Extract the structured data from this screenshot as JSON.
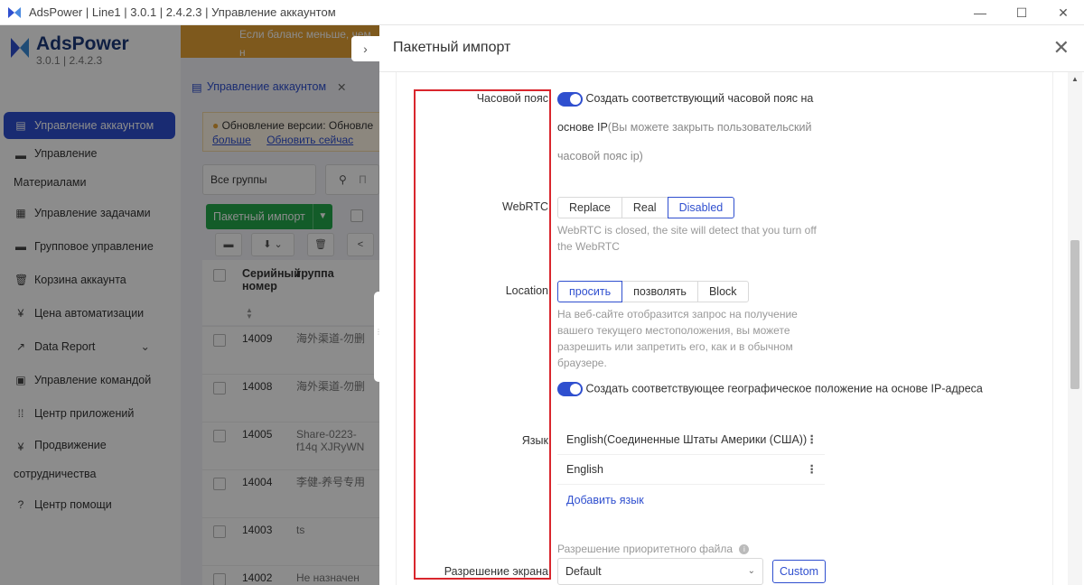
{
  "window": {
    "title": "AdsPower | Line1 | 3.0.1 | 2.4.2.3 | Управление аккаунтом",
    "minimize_glyph": "—",
    "maximize_glyph": "☐",
    "close_glyph": "✕"
  },
  "brand": {
    "name": "AdsPower",
    "version": "3.0.1 | 2.4.2.3"
  },
  "sidebar": {
    "items": [
      {
        "label": "Управление аккаунтом",
        "icon": "list-icon",
        "active": true
      },
      {
        "label_line1": "Управление",
        "label_line2": "Материалами",
        "icon": "folder-icon"
      },
      {
        "label": "Управление задачами",
        "icon": "tasks-icon"
      },
      {
        "label": "Групповое управление",
        "icon": "group-icon"
      },
      {
        "label": "Корзина аккаунта",
        "icon": "trash-icon"
      },
      {
        "label": "Цена автоматизации",
        "icon": "price-icon"
      },
      {
        "label": "Data Report",
        "icon": "chart-icon",
        "has_chevron": true
      },
      {
        "label": "Управление командой",
        "icon": "team-icon"
      },
      {
        "label": "Центр приложений",
        "icon": "apps-icon"
      },
      {
        "label_line1": "Продвижение",
        "label_line2": "сотрудничества",
        "icon": "promo-icon"
      },
      {
        "label": "Центр помощи",
        "icon": "help-icon"
      }
    ]
  },
  "banner": {
    "text": "Если баланс меньше, чем н"
  },
  "content": {
    "tab_label": "Управление аккаунтом",
    "tab_close": "✕",
    "notice_text": "Обновление версии: Обновле",
    "notice_link_more": "больше",
    "notice_link_update": "Обновить сейчас",
    "groups_select": "Все группы",
    "search_placeholder": "П",
    "import_button": "Пакетный импорт",
    "col_serial": "Серийный номер",
    "col_group": "группа",
    "rows": [
      {
        "serial": "14009",
        "group": "海外渠道-勿删"
      },
      {
        "serial": "14008",
        "group": "海外渠道-勿删"
      },
      {
        "serial": "14005",
        "group": "Share-0223-f14q XJRyWN"
      },
      {
        "serial": "14004",
        "group": "李健-养号专用"
      },
      {
        "serial": "14003",
        "group": "ts"
      },
      {
        "serial": "14002",
        "group": "Не назначен"
      }
    ]
  },
  "drawer": {
    "title": "Пакетный импорт",
    "close_glyph": "✕",
    "timezone": {
      "label": "Часовой пояс",
      "toggle_on": true,
      "text_main": "Создать соответствующий часовой пояс на",
      "text_line2": "основе IP",
      "text_muted": "(Вы можете закрыть пользовательский",
      "text_line3": "часовой пояс ip)"
    },
    "webrtc": {
      "label": "WebRTC",
      "options": [
        "Replace",
        "Real",
        "Disabled"
      ],
      "selected": "Disabled",
      "hint_line1": "WebRTC is closed, the site will detect that you turn off",
      "hint_line2": "the WebRTC"
    },
    "location": {
      "label": "Location",
      "options": [
        "просить",
        "позволять",
        "Block"
      ],
      "selected": "просить",
      "hint_line1": "На веб-сайте отобразится запрос на получение",
      "hint_line2": "вашего текущего местоположения, вы можете",
      "hint_line3": "разрешить или запретить его, как и в обычном",
      "hint_line4": "браузере.",
      "geo_toggle_on": true,
      "geo_text": "Создать соответствующее географическое положение на основе IP-адреса"
    },
    "language": {
      "label": "Язык",
      "items": [
        "English(Соединенные Штаты Америки (США))",
        "English"
      ],
      "add_label": "Добавить язык"
    },
    "resolution": {
      "label": "Разрешение экрана",
      "priority_label": "Разрешение приоритетного файла",
      "select_value": "Default",
      "custom_button": "Custom"
    }
  },
  "colors": {
    "accent": "#2f4fcf",
    "highlight": "#d9262d",
    "import_green": "#23a84c",
    "banner": "#e5a235"
  }
}
